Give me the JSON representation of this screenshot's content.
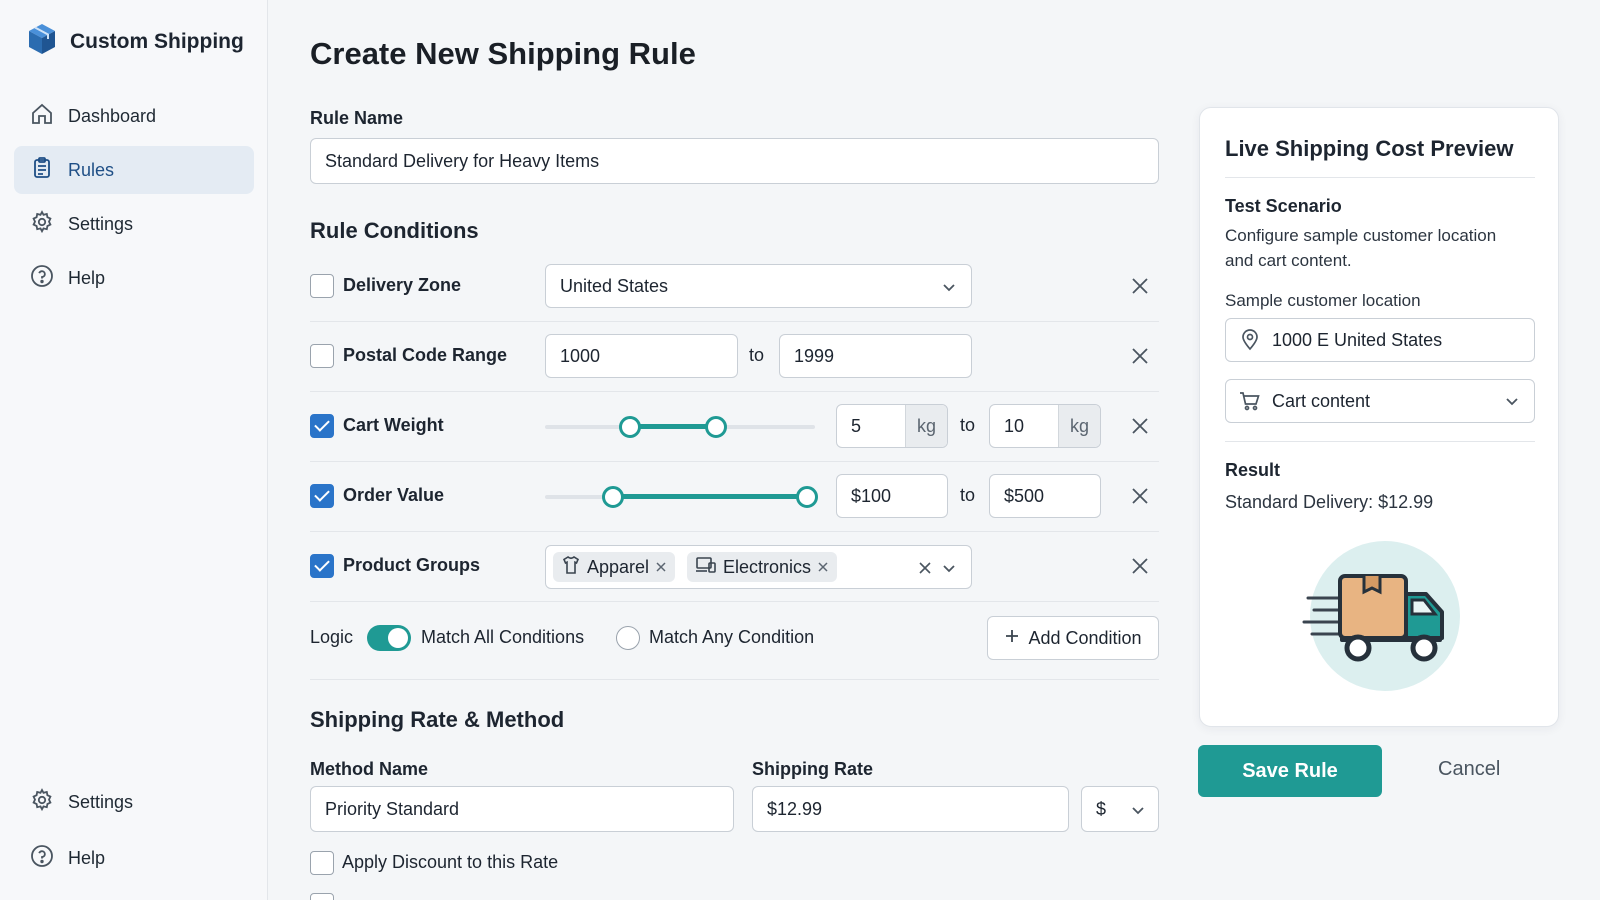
{
  "app": {
    "name": "Custom Shipping"
  },
  "sidebar": {
    "items": [
      {
        "label": "Dashboard",
        "icon": "home-icon"
      },
      {
        "label": "Rules",
        "icon": "clipboard-icon",
        "active": true
      },
      {
        "label": "Settings",
        "icon": "gear-icon"
      },
      {
        "label": "Help",
        "icon": "help-icon"
      }
    ],
    "bottom_items": [
      {
        "label": "Settings",
        "icon": "gear-icon"
      },
      {
        "label": "Help",
        "icon": "help-icon"
      }
    ]
  },
  "page": {
    "title": "Create New Shipping Rule"
  },
  "rule_name": {
    "label": "Rule Name",
    "value": "Standard Delivery for Heavy Items"
  },
  "conditions": {
    "title": "Rule Conditions",
    "delivery_zone": {
      "label": "Delivery Zone",
      "checked": false,
      "value": "United States"
    },
    "postal_code": {
      "label": "Postal Code Range",
      "checked": false,
      "from": "1000",
      "to_label": "to",
      "to": "1999"
    },
    "cart_weight": {
      "label": "Cart Weight",
      "checked": true,
      "from": "5",
      "from_unit": "kg",
      "to_label": "to",
      "to": "10",
      "to_unit": "kg"
    },
    "order_value": {
      "label": "Order Value",
      "checked": true,
      "from": "$100",
      "to_label": "to",
      "to": "$500"
    },
    "product_groups": {
      "label": "Product Groups",
      "checked": true,
      "chips": [
        "Apparel",
        "Electronics"
      ]
    },
    "logic": {
      "label": "Logic",
      "match_all": "Match All Conditions",
      "match_any": "Match Any Condition",
      "match_all_on": true
    },
    "add_button": "Add Condition"
  },
  "rate": {
    "title": "Shipping Rate & Method",
    "method_label": "Method Name",
    "method_value": "Priority Standard",
    "rate_label": "Shipping Rate",
    "rate_value": "$12.99",
    "currency": "$",
    "discount_label": "Apply Discount to this Rate"
  },
  "preview": {
    "title": "Live Shipping Cost Preview",
    "scenario_title": "Test Scenario",
    "scenario_desc_1": "Configure sample customer location",
    "scenario_desc_2": "and cart content.",
    "location_label": "Sample customer location",
    "location_value": "1000 E United States",
    "cart_select": "Cart content",
    "result_title": "Result",
    "result_value": "Standard Delivery: $12.99"
  },
  "actions": {
    "save": "Save Rule",
    "cancel": "Cancel"
  },
  "colors": {
    "accent": "#1f9a94",
    "checkbox": "#2a74c9",
    "active_nav_bg": "#e4ebf3",
    "active_nav_text": "#1f4f86"
  }
}
